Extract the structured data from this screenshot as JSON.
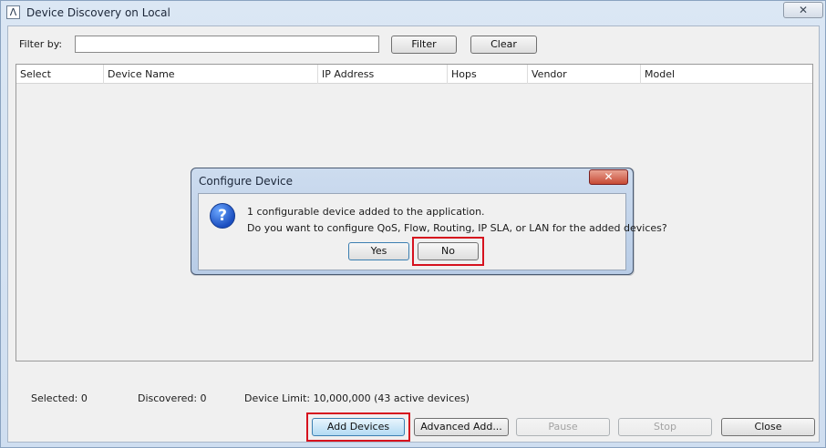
{
  "window": {
    "title": "Device Discovery on Local",
    "close_glyph": "✕"
  },
  "filter": {
    "label": "Filter by:",
    "value": "",
    "filter_button": "Filter",
    "clear_button": "Clear"
  },
  "table": {
    "columns": [
      "Select",
      "Device Name",
      "IP Address",
      "Hops",
      "Vendor",
      "Model"
    ],
    "rows": []
  },
  "status": {
    "selected": "Selected: 0",
    "discovered": "Discovered: 0",
    "device_limit": "Device Limit: 10,000,000 (43 active devices)"
  },
  "buttons": {
    "add_devices": "Add Devices",
    "advanced_add": "Advanced Add...",
    "pause": "Pause",
    "stop": "Stop",
    "close": "Close"
  },
  "dialog": {
    "title": "Configure Device",
    "close_glyph": "✕",
    "icon": "question-icon",
    "message_line1": "1 configurable device added to the application.",
    "message_line2": "Do you want to configure QoS, Flow, Routing, IP SLA, or LAN for the added devices?",
    "yes_button": "Yes",
    "no_button": "No"
  },
  "colors": {
    "highlight": "#d6121e",
    "accent": "#3c7fb1"
  }
}
